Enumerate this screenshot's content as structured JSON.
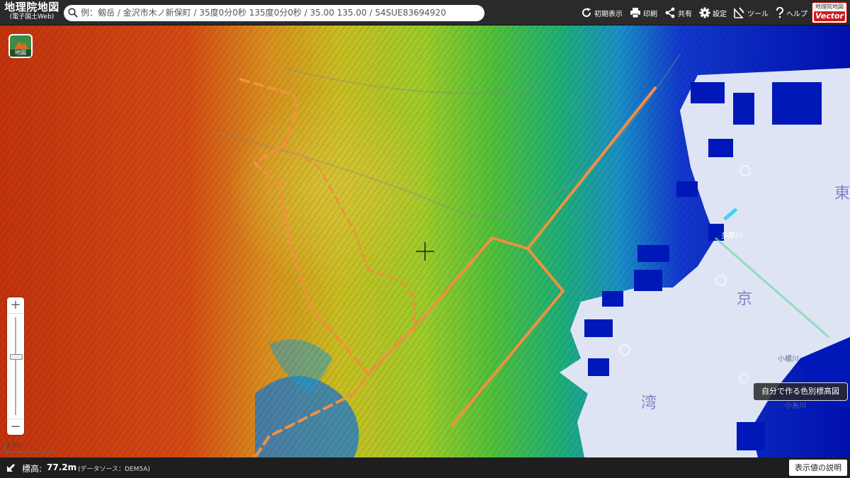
{
  "header": {
    "logo_title": "地理院地図",
    "logo_subtitle": "(電子国土Web)",
    "search_placeholder": "例：剱岳 / 金沢市木ノ新保町 / 35度0分0秒 135度0分0秒 / 35.00 135.00 / 54SUE83694920",
    "tools": [
      {
        "label": "初期表示",
        "icon": "refresh-icon"
      },
      {
        "label": "印刷",
        "icon": "print-icon"
      },
      {
        "label": "共有",
        "icon": "share-icon"
      },
      {
        "label": "設定",
        "icon": "gear-icon"
      },
      {
        "label": "ツール",
        "icon": "tools-icon"
      },
      {
        "label": "ヘルプ",
        "icon": "help-icon"
      }
    ],
    "vector_badge_top": "地理院地図",
    "vector_badge_label": "Vector"
  },
  "map": {
    "layer_button_label": "地図",
    "scale_label": "5 km",
    "custom_legend_button": "自分で作る色別標高図",
    "place_labels": {
      "east_1": "東",
      "east_2": "京",
      "bay": "湾",
      "river_1": "多摩川",
      "river_2": "小櫃川",
      "river_3": "小糸川"
    }
  },
  "footer": {
    "elevation_label": "標高:",
    "elevation_value": "77.2m",
    "data_source": "(データソース：DEM5A)",
    "explain_button": "表示値の説明"
  },
  "colors": {
    "header_bg": "#2a2a2a",
    "sea": "#dfe4f5",
    "deep_blue": "#0010b0",
    "route_orange": "#f09040",
    "mountain_red": "#cc3a10"
  }
}
